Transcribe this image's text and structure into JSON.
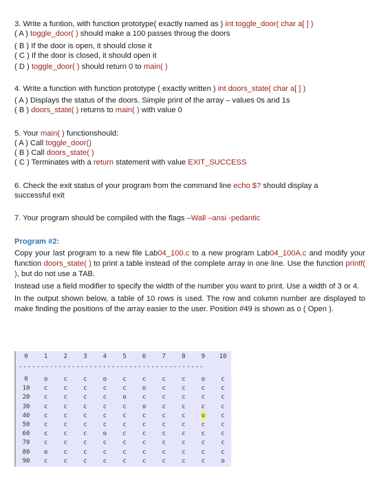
{
  "item3": {
    "l1_pre": "3. Write a funtion, with function prototype( exactly named as ) ",
    "l1_code": "int toggle_door( char a[ ] )",
    "a_pre": "( A ) ",
    "a_code": "toggle_door( )",
    "a_post": " should make a 100 passes throug the doors",
    "b": "( B ) If the door is open, it should close it",
    "c": "( C ) If the door is closed, it should open it",
    "d_pre": "( D ) ",
    "d_code": "toggle_door( )",
    "d_mid": " should return 0 to ",
    "d_code2": "main( )"
  },
  "item4": {
    "l1_pre": "4. Write a function with function prototype ( exactly written ) ",
    "l1_code": "int doors_state( char a[ ] )",
    "a": "( A ) Displays the status of the doors. Simple print of the array – values 0s and 1s",
    "b_pre": "( B ) ",
    "b_code": "doors_state( )",
    "b_mid": " returns to ",
    "b_code2": "main( )",
    "b_post": " with value 0"
  },
  "item5": {
    "l1_pre": "5. Your ",
    "l1_code": "main( )",
    "l1_post": " functionshould:",
    "a_pre": "( A ) Call ",
    "a_code": "toggle_door()",
    "b_pre": "( B ) Call ",
    "b_code": "doors_state( )",
    "c_pre": "( C ) Terminates  with a ",
    "c_code": "return",
    "c_mid": " statement with value ",
    "c_code2": "EXIT_SUCCESS"
  },
  "item6": {
    "pre": "6. Check the exit status of your program from the command  line ",
    "code": "echo $?",
    "post": " should display a",
    "l2": "successful exit"
  },
  "item7": {
    "pre": "7. Your program should be compiled with the flags –",
    "code": "Wall –ansi -pedantic"
  },
  "program2": {
    "heading": "Program #2:",
    "p1_a": "Copy your last program to a new file Lab",
    "p1_b": "04_100.c",
    "p1_c": " to a new program Lab",
    "p1_d": "04_100A.c",
    "p1_e": " and modify your function ",
    "p1_f": "doors_state( )",
    "p1_g": " to print a table instead of the complete array in one line. Use the function ",
    "p1_h": "printf( )",
    "p1_i": ", but do not use a TAB.",
    "p2": "Instead use a field modifier to specify the width of the number you want to print. Use a width of 3 or 4.",
    "p3": "In the output shown below, a table of 10 rows is used. The row and column number are displayed to make finding the positions of the array easier to the user. Position #49 is shown as o ( Open )."
  },
  "table": {
    "header": [
      "0",
      "1",
      "2",
      "3",
      "4",
      "5",
      "6",
      "7",
      "8",
      "9",
      "10"
    ],
    "separator": "------------------------------------------",
    "highlight": {
      "row": 4,
      "col": 9
    },
    "rows": [
      {
        "label": "0",
        "cells": [
          "o",
          "c",
          "c",
          "o",
          "c",
          "c",
          "c",
          "c",
          "o",
          "c"
        ]
      },
      {
        "label": "10",
        "cells": [
          "c",
          "c",
          "c",
          "c",
          "c",
          "o",
          "c",
          "c",
          "c",
          "c"
        ]
      },
      {
        "label": "20",
        "cells": [
          "c",
          "c",
          "c",
          "c",
          "o",
          "c",
          "c",
          "c",
          "c",
          "c"
        ]
      },
      {
        "label": "30",
        "cells": [
          "c",
          "c",
          "c",
          "c",
          "c",
          "o",
          "c",
          "c",
          "c",
          "c"
        ]
      },
      {
        "label": "40",
        "cells": [
          "c",
          "c",
          "c",
          "c",
          "c",
          "c",
          "c",
          "c",
          "o",
          "c"
        ]
      },
      {
        "label": "50",
        "cells": [
          "c",
          "c",
          "c",
          "c",
          "c",
          "c",
          "c",
          "c",
          "c",
          "c"
        ]
      },
      {
        "label": "60",
        "cells": [
          "c",
          "c",
          "c",
          "o",
          "c",
          "c",
          "c",
          "c",
          "c",
          "c"
        ]
      },
      {
        "label": "70",
        "cells": [
          "c",
          "c",
          "c",
          "c",
          "c",
          "c",
          "c",
          "c",
          "c",
          "c"
        ]
      },
      {
        "label": "80",
        "cells": [
          "o",
          "c",
          "c",
          "c",
          "c",
          "c",
          "c",
          "c",
          "c",
          "c"
        ]
      },
      {
        "label": "90",
        "cells": [
          "c",
          "c",
          "c",
          "c",
          "c",
          "c",
          "c",
          "c",
          "c",
          "o"
        ]
      }
    ]
  }
}
